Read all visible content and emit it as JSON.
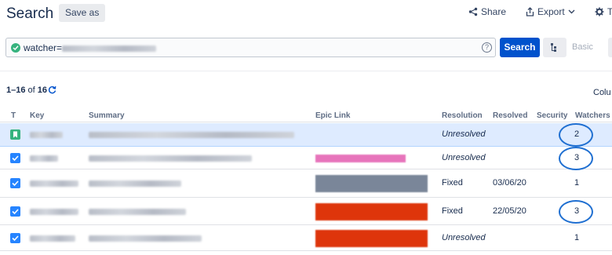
{
  "header": {
    "title": "Search",
    "save_as": "Save as",
    "share": "Share",
    "export": "Export",
    "tools": "To"
  },
  "search": {
    "query_prefix": "watcher=",
    "help": "?",
    "search_button": "Search",
    "basic_link": "Basic"
  },
  "results": {
    "range": "1–16",
    "of": "of",
    "total": "16",
    "columns_link": "Colu"
  },
  "table": {
    "headers": {
      "type": "T",
      "key": "Key",
      "summary": "Summary",
      "epic": "Epic Link",
      "resolution": "Resolution",
      "resolved": "Resolved",
      "security": "Security",
      "watchers": "Watchers"
    },
    "rows": [
      {
        "type": "story",
        "resolution": "Unresolved",
        "resolved": "",
        "watchers": "2",
        "highlighted": true,
        "selected": true,
        "epic_color": ""
      },
      {
        "type": "task",
        "resolution": "Unresolved",
        "resolved": "",
        "watchers": "3",
        "highlighted": true,
        "selected": false,
        "epic_color": "#e774bb"
      },
      {
        "type": "task",
        "resolution": "Fixed",
        "resolved": "03/06/20",
        "watchers": "1",
        "highlighted": false,
        "selected": false,
        "epic_color": "#7a8699"
      },
      {
        "type": "task",
        "resolution": "Fixed",
        "resolved": "22/05/20",
        "watchers": "3",
        "highlighted": true,
        "selected": false,
        "epic_color": "#de350b"
      },
      {
        "type": "task",
        "resolution": "Unresolved",
        "resolved": "",
        "watchers": "1",
        "highlighted": false,
        "selected": false,
        "epic_color": "#de350b"
      }
    ]
  },
  "colors": {
    "primary": "#0052cc",
    "selected_row": "#deebff",
    "annotation_ring": "#1f6fd1",
    "valid": "#36b37e"
  }
}
